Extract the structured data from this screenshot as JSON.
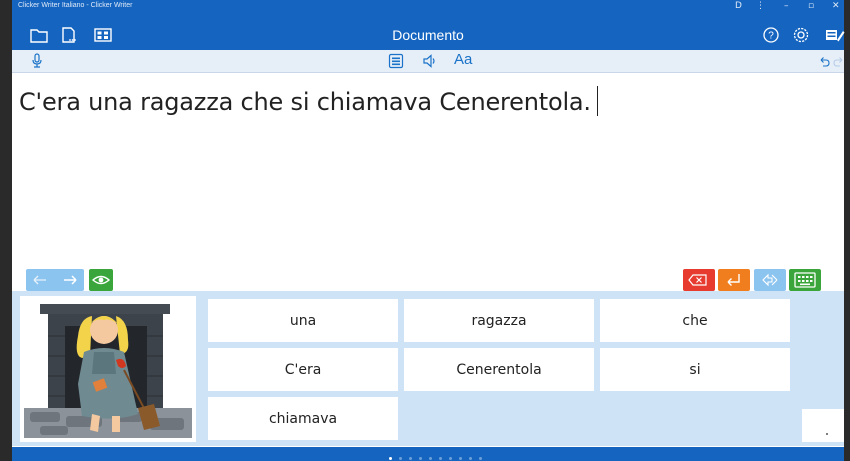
{
  "window": {
    "title": "Clicker Writer Italiano - Clicker Writer",
    "controls": [
      "D",
      "⋮",
      "–",
      "▫",
      "✕"
    ]
  },
  "header": {
    "doc_title": "Documento",
    "icons": [
      "folder-icon",
      "open-file-icon",
      "grid-set-icon",
      "help-icon",
      "settings-icon",
      "writer-mode-icon"
    ]
  },
  "toolbar": {
    "font_label": "Aa",
    "icons": [
      "microphone-icon",
      "list-icon",
      "speaker-icon",
      "undo-icon",
      "redo-icon"
    ]
  },
  "document": {
    "text": "C'era una ragazza che si chiamava Cenerentola."
  },
  "grid": {
    "picture": "cinderella-sweeping-illustration",
    "words": [
      "una",
      "ragazza",
      "che",
      "C'era",
      "Cenerentola",
      "si",
      "chiamava"
    ]
  },
  "pager": {
    "pages": 10,
    "current": 1
  },
  "colors": {
    "header_blue": "#1565c0",
    "grid_bg": "#cfe3f7",
    "delete_red": "#e63b2e",
    "return_orange": "#f07e1e",
    "green": "#3aa53a",
    "light_blue": "#8cc4f0"
  }
}
